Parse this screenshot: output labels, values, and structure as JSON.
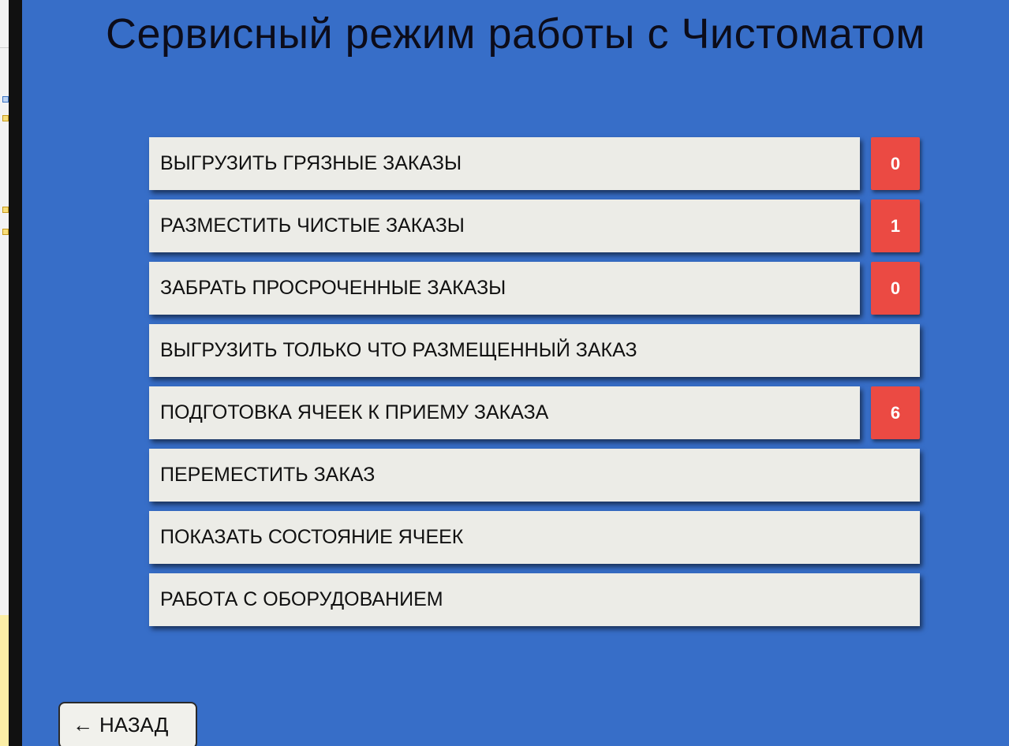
{
  "header": {
    "title": "Сервисный режим работы с Чистоматом"
  },
  "menu": {
    "items": [
      {
        "label": "ВЫГРУЗИТЬ ГРЯЗНЫЕ ЗАКАЗЫ",
        "badge": "0"
      },
      {
        "label": "РАЗМЕСТИТЬ ЧИСТЫЕ ЗАКАЗЫ",
        "badge": "1"
      },
      {
        "label": "ЗАБРАТЬ ПРОСРОЧЕННЫЕ ЗАКАЗЫ",
        "badge": "0"
      },
      {
        "label": "ВЫГРУЗИТЬ ТОЛЬКО ЧТО РАЗМЕЩЕННЫЙ ЗАКАЗ"
      },
      {
        "label": "ПОДГОТОВКА ЯЧЕЕК К ПРИЕМУ ЗАКАЗА",
        "badge": "6"
      },
      {
        "label": "ПЕРЕМЕСТИТЬ ЗАКАЗ"
      },
      {
        "label": "ПОКАЗАТЬ СОСТОЯНИЕ ЯЧЕЕК"
      },
      {
        "label": "РАБОТА С ОБОРУДОВАНИЕМ"
      }
    ]
  },
  "footer": {
    "back_arrow": "←",
    "back_label": "НАЗАД"
  },
  "colors": {
    "background": "#376ec8",
    "button": "#ecece7",
    "badge": "#eb4a43"
  }
}
